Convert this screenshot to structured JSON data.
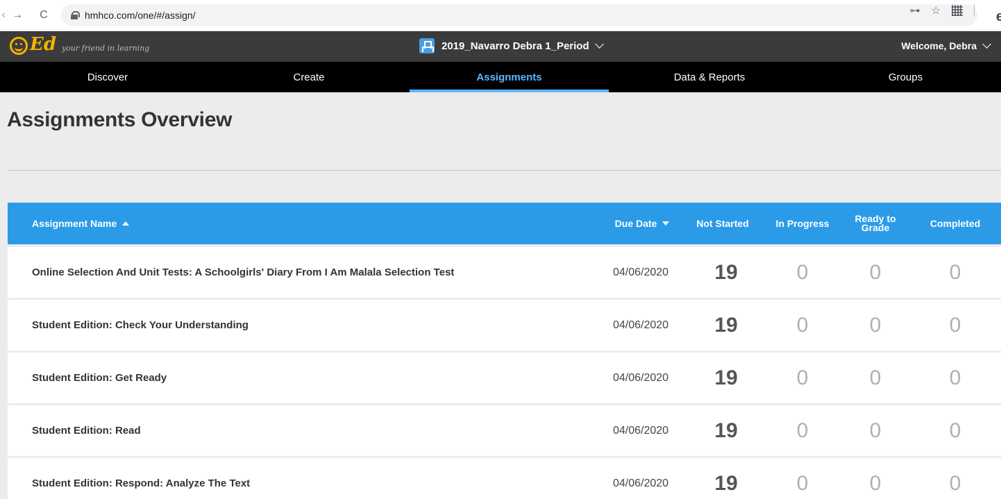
{
  "browser": {
    "url": "hmhco.com/one/#/assign/"
  },
  "header": {
    "logo_text": "Ed",
    "logo_tagline": "your friend in learning",
    "class_name": "2019_Navarro Debra 1_Period",
    "welcome": "Welcome, Debra"
  },
  "nav": {
    "items": [
      {
        "label": "Discover"
      },
      {
        "label": "Create"
      },
      {
        "label": "Assignments",
        "active": true
      },
      {
        "label": "Data & Reports"
      },
      {
        "label": "Groups"
      }
    ]
  },
  "page": {
    "title": "Assignments Overview"
  },
  "table": {
    "columns": {
      "name": "Assignment Name",
      "due": "Due Date",
      "not_started": "Not Started",
      "in_progress": "In Progress",
      "ready_line1": "Ready to",
      "ready_line2": "Grade",
      "completed": "Completed"
    },
    "rows": [
      {
        "name": "Online Selection And Unit Tests: A Schoolgirls' Diary From I Am Malala Selection Test",
        "due": "04/06/2020",
        "not_started": "19",
        "in_progress": "0",
        "ready": "0",
        "completed": "0"
      },
      {
        "name": "Student Edition: Check Your Understanding",
        "due": "04/06/2020",
        "not_started": "19",
        "in_progress": "0",
        "ready": "0",
        "completed": "0"
      },
      {
        "name": "Student Edition: Get Ready",
        "due": "04/06/2020",
        "not_started": "19",
        "in_progress": "0",
        "ready": "0",
        "completed": "0"
      },
      {
        "name": "Student Edition: Read",
        "due": "04/06/2020",
        "not_started": "19",
        "in_progress": "0",
        "ready": "0",
        "completed": "0"
      },
      {
        "name": "Student Edition: Respond: Analyze The Text",
        "due": "04/06/2020",
        "not_started": "19",
        "in_progress": "0",
        "ready": "0",
        "completed": "0"
      }
    ]
  },
  "colors": {
    "accent": "#2b9be8",
    "active_tab": "#5eb6ff",
    "logo": "#f4b400"
  }
}
